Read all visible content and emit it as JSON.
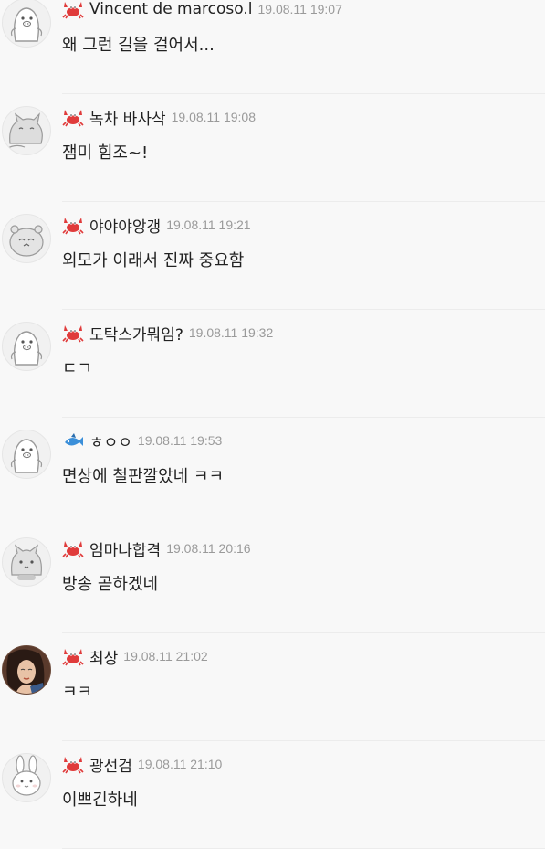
{
  "colors": {
    "background": "#f8f8f8",
    "crab_badge": "#e03b3b",
    "fish_badge": "#3b8fd9",
    "nickname": "#222222",
    "date": "#9a9a9a"
  },
  "comments": [
    {
      "nickname": "Vincent de marcoso.l",
      "date": "19.08.11 19:07",
      "text": "왜 그런 길을 걸어서...",
      "badge": "crab-icon",
      "avatar": "penguin-avatar"
    },
    {
      "nickname": "녹차 바사삭",
      "date": "19.08.11 19:08",
      "text": "잼미 힘조~!",
      "badge": "crab-icon",
      "avatar": "cat-avatar"
    },
    {
      "nickname": "야야야앙갱",
      "date": "19.08.11 19:21",
      "text": "외모가 이래서 진짜 중요함",
      "badge": "crab-icon",
      "avatar": "hamster-avatar"
    },
    {
      "nickname": "도탁스가뭐임?",
      "date": "19.08.11 19:32",
      "text": "ㄷㄱ",
      "badge": "crab-icon",
      "avatar": "penguin-avatar"
    },
    {
      "nickname": "ㅎㅇㅇ",
      "date": "19.08.11 19:53",
      "text": "면상에 철판깔았네 ㅋㅋ",
      "badge": "fish-icon",
      "avatar": "penguin-avatar"
    },
    {
      "nickname": "엄마나합격",
      "date": "19.08.11 20:16",
      "text": "방송 곧하겠네",
      "badge": "crab-icon",
      "avatar": "cat-avatar"
    },
    {
      "nickname": "최상",
      "date": "19.08.11 21:02",
      "text": "ㅋㅋ",
      "badge": "crab-icon",
      "avatar": "photo-avatar"
    },
    {
      "nickname": "광선검",
      "date": "19.08.11 21:10",
      "text": "이쁘긴하네",
      "badge": "crab-icon",
      "avatar": "rabbit-avatar"
    }
  ]
}
